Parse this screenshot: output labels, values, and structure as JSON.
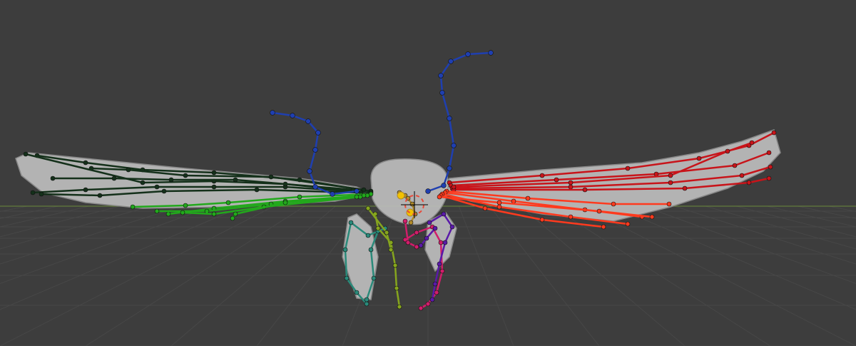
{
  "viewport": {
    "background": "#3d3d3d",
    "grid_color": "#474747",
    "horizon_color": "#6b8a3a"
  },
  "mesh": {
    "fill": "#bdbdbd",
    "stroke": "#8f8f8f"
  },
  "armature": {
    "bone_groups": [
      {
        "id": "left-wing-upper",
        "color": "#14301a"
      },
      {
        "id": "left-wing-lower",
        "color": "#22a81c"
      },
      {
        "id": "antennae",
        "color": "#1f3fb0"
      },
      {
        "id": "right-wing-upper",
        "color": "#c8141a"
      },
      {
        "id": "right-wing-lower",
        "color": "#ff3a1e"
      },
      {
        "id": "leg-teal",
        "color": "#2a8a7a"
      },
      {
        "id": "leg-olive",
        "color": "#86a51e"
      },
      {
        "id": "leg-pink",
        "color": "#d01e6a"
      },
      {
        "id": "leg-purple",
        "color": "#5a1aa8"
      },
      {
        "id": "head",
        "color": "#b08a2a"
      }
    ]
  },
  "cursor_3d": {
    "color_a": "#e84a3a",
    "color_b": "#ffffff"
  }
}
